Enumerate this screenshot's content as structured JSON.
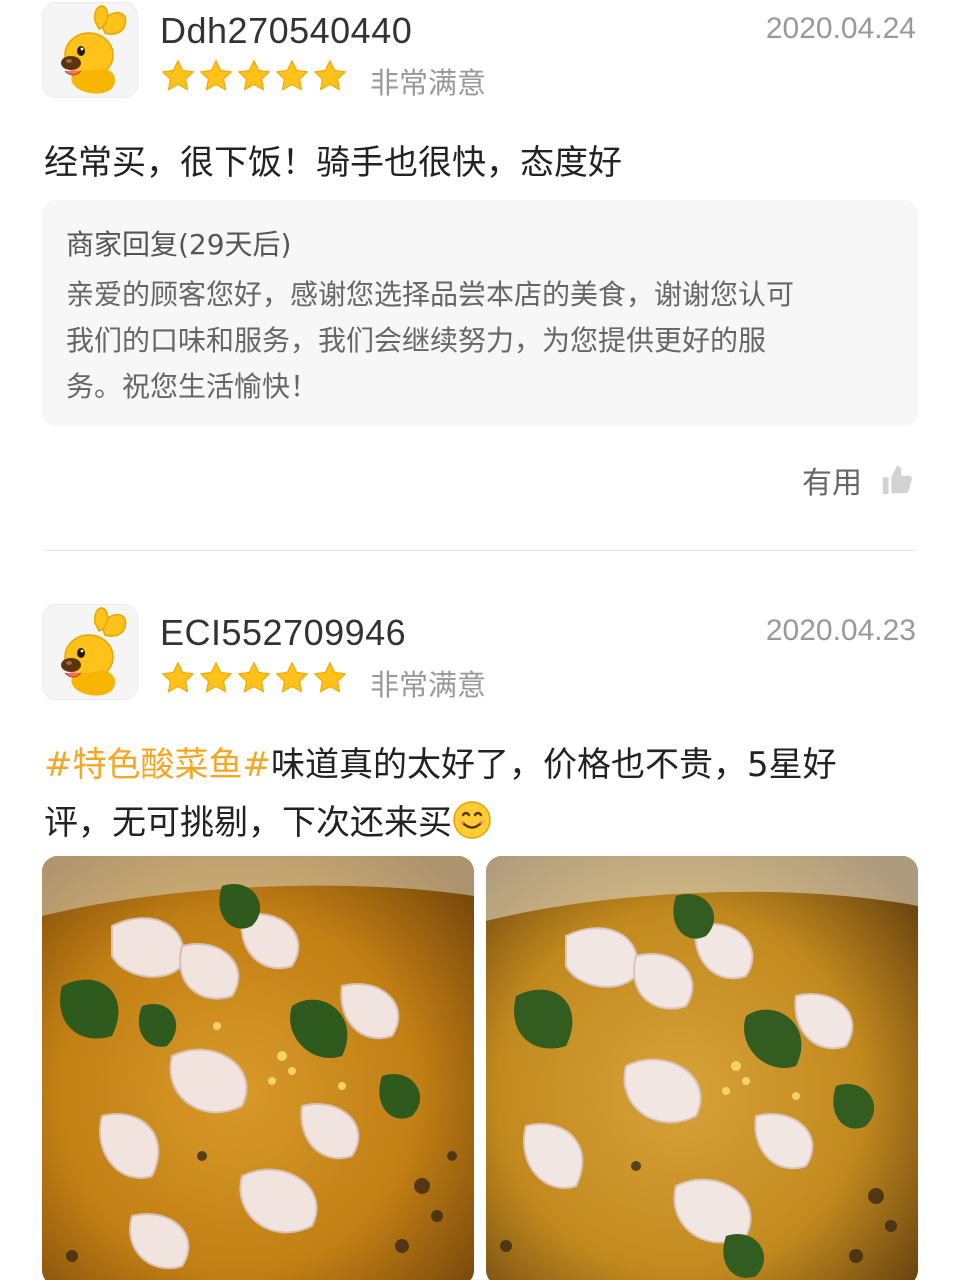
{
  "reviews": [
    {
      "username": "Ddh270540440",
      "date": "2020.04.24",
      "rating": 5,
      "satisfaction": "非常满意",
      "text": "经常买，很下饭！骑手也很快，态度好",
      "merchant_reply": {
        "title": "商家回复(29天后)",
        "lines": [
          "亲爱的顾客您好，感谢您选择品尝本店的美食，谢谢您认可",
          "我们的口味和服务，我们会继续努力，为您提供更好的服",
          "务。祝您生活愉快！"
        ]
      },
      "useful_label": "有用"
    },
    {
      "username": "ECI552709946",
      "date": "2020.04.23",
      "rating": 5,
      "satisfaction": "非常满意",
      "hashtag": "#特色酸菜鱼#",
      "text_line1": "味道真的太好了，价格也不贵，5星好",
      "text_line2": "评，无可挑剔，下次还来买",
      "emoji": "smiling-face-emoji",
      "photos": [
        "suancai-fish-photo-1",
        "suancai-fish-photo-2"
      ]
    }
  ],
  "colors": {
    "star": "#ffc21a",
    "hashtag": "#f5a623",
    "date": "#999999",
    "reply_bg": "#f7f7f7"
  }
}
